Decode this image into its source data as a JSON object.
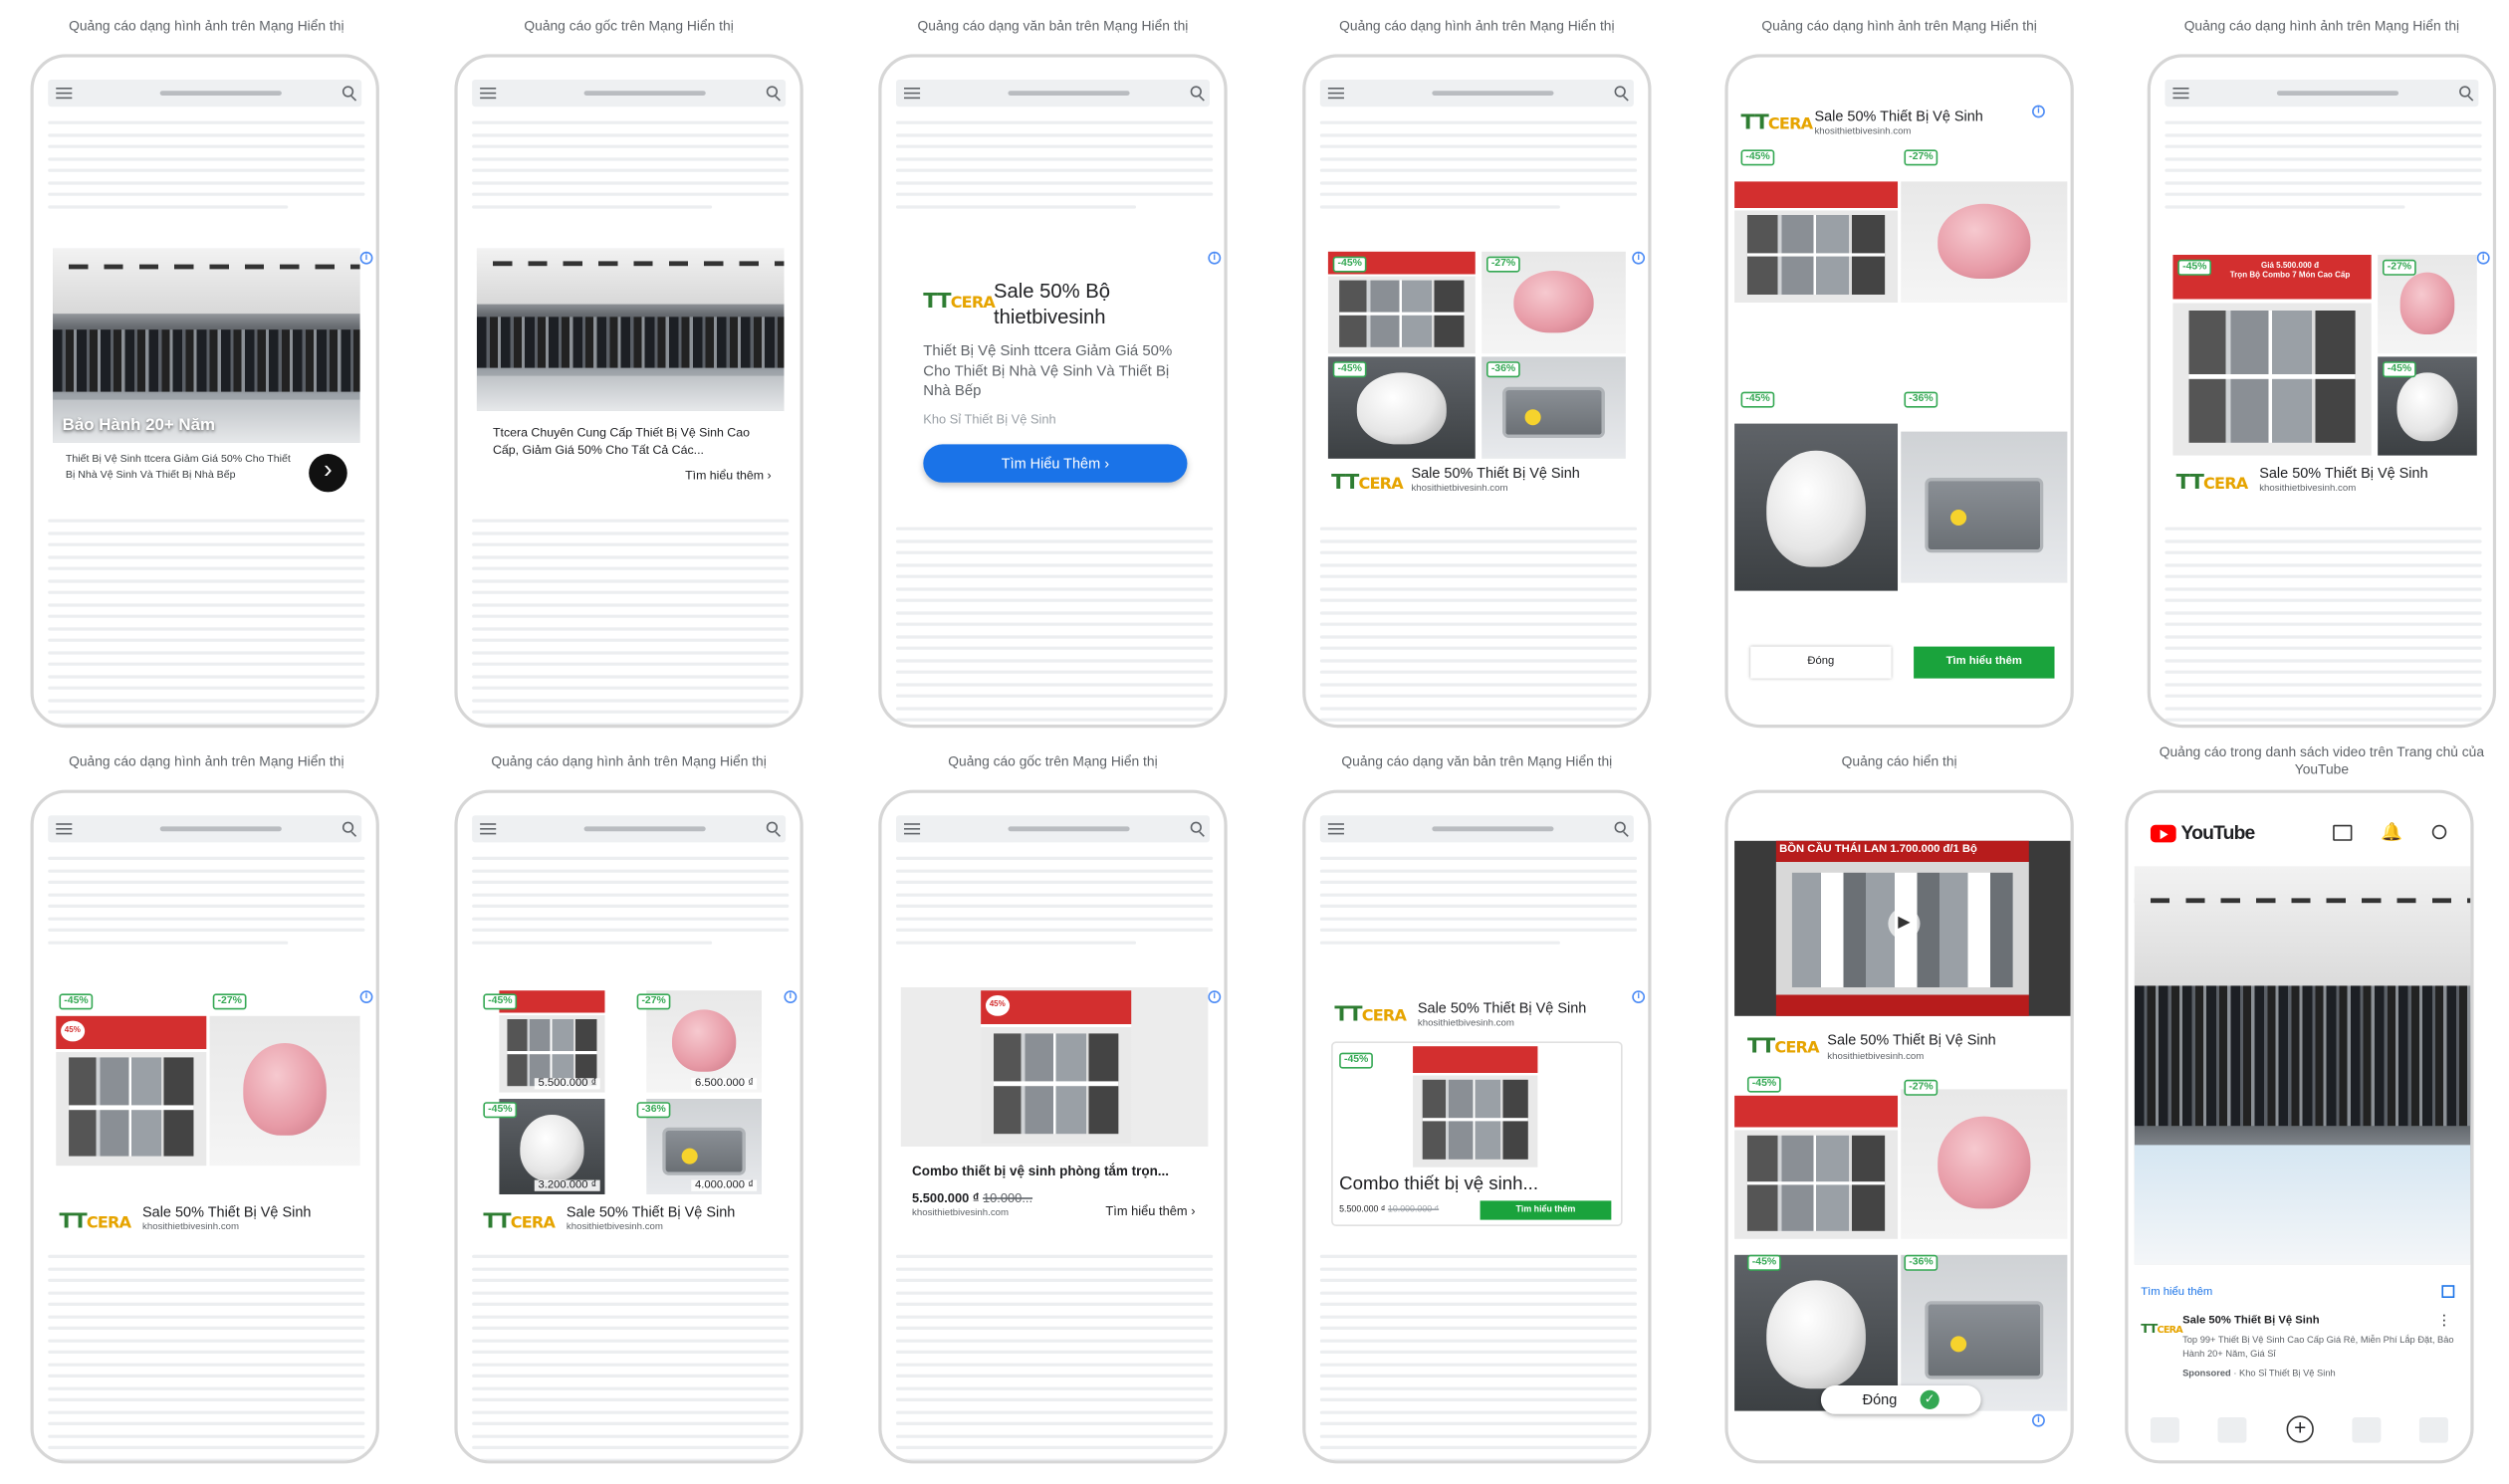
{
  "captions": [
    "Quảng cáo dạng hình ảnh trên Mạng Hiển thị",
    "Quảng cáo gốc trên Mạng Hiển thị",
    "Quảng cáo dạng văn bản trên Mạng Hiển thị",
    "Quảng cáo dạng hình ảnh trên Mạng Hiển thị",
    "Quảng cáo dạng hình ảnh trên Mạng Hiển thị",
    "Quảng cáo dạng hình ảnh trên Mạng Hiển thị",
    "Quảng cáo dạng hình ảnh trên Mạng Hiển thị",
    "Quảng cáo dạng hình ảnh trên Mạng Hiển thị",
    "Quảng cáo gốc trên Mạng Hiển thị",
    "Quảng cáo dạng văn bản trên Mạng Hiển thị",
    "Quảng cáo hiển thị",
    "Quảng cáo trong danh sách video trên Trang chủ của YouTube"
  ],
  "brand": {
    "logo_a": "TT",
    "logo_b": "CERA",
    "name": "Sale 50% Thiết Bị Vệ Sinh",
    "url": "khosithietbivesinh.com"
  },
  "ad1": {
    "overlay": "Bảo Hành 20+ Năm",
    "desc": "Thiết Bị Vệ Sinh ttcera Giảm Giá 50% Cho Thiết Bị Nhà Vệ Sinh Và Thiết Bị Nhà Bếp"
  },
  "ad2": {
    "title": "Ttcera Chuyên Cung Cấp Thiết Bị Vệ Sinh Cao Cấp, Giảm Giá 50% Cho Tất Cả Các...",
    "cta": "Tìm hiểu thêm"
  },
  "ad3": {
    "title": "Sale 50% Bộ thietbivesinh",
    "desc": "Thiết Bị Vệ Sinh ttcera Giảm Giá 50% Cho Thiết Bị Nhà Vệ Sinh Và Thiết Bị Nhà Bếp",
    "source": "Kho Sỉ Thiết Bị Vệ Sinh",
    "cta": "Tìm Hiểu Thêm"
  },
  "discounts": {
    "a": "-45%",
    "b": "-27%",
    "c": "-45%",
    "d": "-36%"
  },
  "banner": {
    "price": "Giá 5.500.000 đ",
    "sub": "Trọn Bộ Combo 7 Món Cao Cấp",
    "pct": "45%"
  },
  "ad5": {
    "close": "Đóng",
    "cta": "Tìm hiểu thêm"
  },
  "ad8": {
    "prices": [
      "5.500.000 ₫",
      "6.500.000 ₫",
      "3.200.000 ₫",
      "4.000.000 ₫"
    ]
  },
  "ad9": {
    "title": "Combo thiết bị vệ sinh phòng tắm trọn...",
    "price": "5.500.000 ₫",
    "old": "10.000...",
    "url": "khosithietbivesinh.com",
    "cta": "Tìm hiểu thêm"
  },
  "ad10": {
    "title": "Combo thiết bị vệ sinh...",
    "price": "5.500.000 ₫",
    "old": "10.000.000 ₫",
    "cta": "Tìm hiểu thêm"
  },
  "ad11": {
    "video_text": "BỒN CẦU THÁI LAN 1.700.000 đ/1 Bộ",
    "close": "Đóng"
  },
  "ad12": {
    "yt": "YouTube",
    "learn": "Tìm hiểu thêm",
    "title": "Sale 50% Thiết Bị Vệ Sinh",
    "desc": "Top 99+ Thiết Bị Vệ Sinh Cao Cấp Giá Rẻ, Miễn Phí Lắp Đặt, Bảo Hành 20+ Năm, Giá Sỉ",
    "sponsored": "Sponsored",
    "source": "Kho Sỉ Thiết Bị Vệ Sinh"
  },
  "info_icon": "i",
  "colors": {
    "blue": "#1a73e8",
    "green": "#1aa33c",
    "red": "#d32f2f",
    "yt_red": "#ff0000"
  }
}
